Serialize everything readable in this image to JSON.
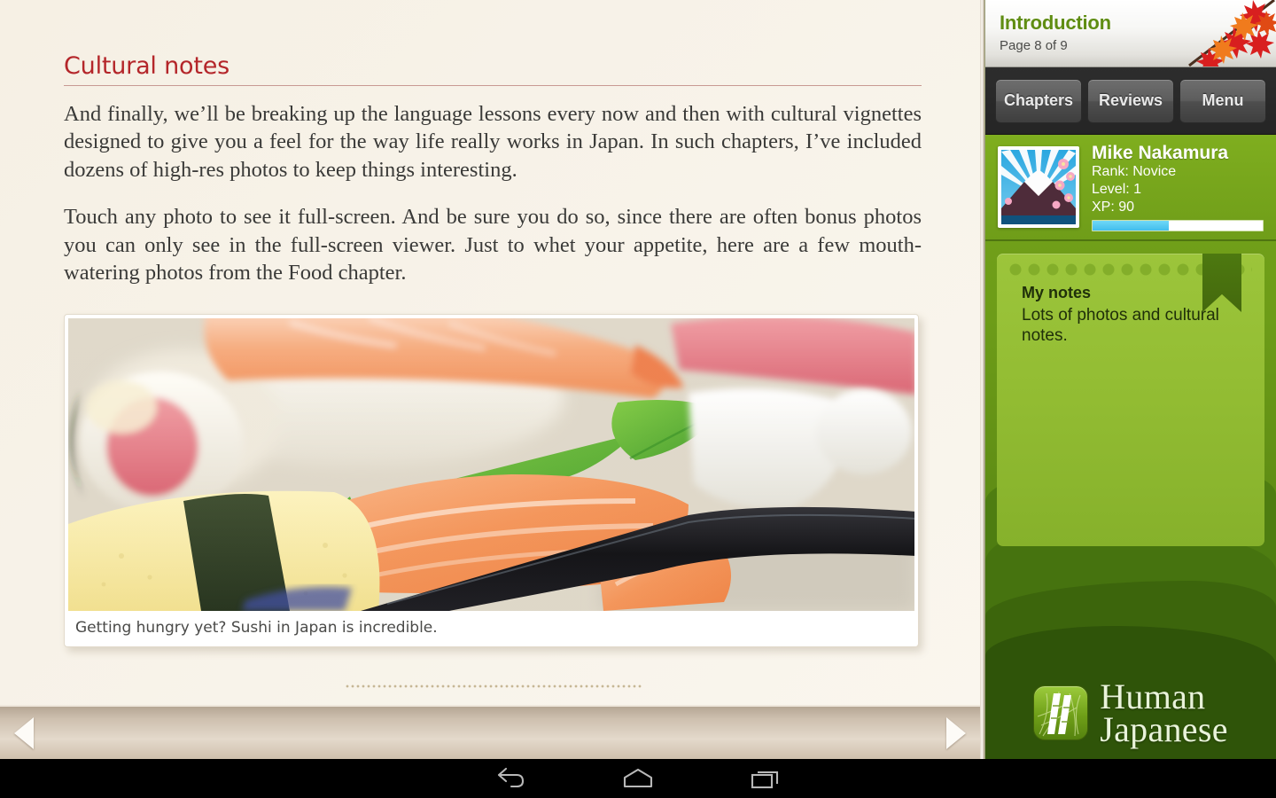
{
  "reader": {
    "heading": "Cultural notes",
    "paragraphs": [
      "And finally, we’ll be breaking up the language lessons every now and then with cultural vignettes designed to give you a feel for the way life really works in Japan. In such chapters, I’ve included dozens of high-res photos to keep things interesting.",
      "Touch any photo to see it full-screen. And be sure you do so, since there are often bonus photos you can only see in the full-screen viewer. Just to whet your appetite, here are a few mouth-watering photos from the Food chapter."
    ],
    "photo": {
      "caption": "Getting hungry yet? Sushi in Japan is incredible.",
      "alt": "sushi-platter-photo"
    },
    "nav": {
      "prev_icon": "triangle-left-icon",
      "next_icon": "triangle-right-icon"
    },
    "divider_icon": "dotted-divider"
  },
  "sidebar": {
    "header": {
      "title": "Introduction",
      "subtitle": "Page 8 of 9",
      "decoration_icon": "maple-leaf-branch-icon"
    },
    "tabs": [
      {
        "label": "Chapters",
        "name": "tab-chapters"
      },
      {
        "label": "Reviews",
        "name": "tab-reviews"
      },
      {
        "label": "Menu",
        "name": "tab-menu"
      }
    ],
    "profile": {
      "name": "Mike Nakamura",
      "rank": "Rank: Novice",
      "level": "Level: 1",
      "xp": "XP: 90",
      "xp_percent": 45,
      "avatar_icon": "mount-fuji-sunrise-avatar"
    },
    "notes": {
      "title": "My notes",
      "body": "Lots of photos and cultural notes.",
      "bookmark_icon": "bookmark-ribbon-icon"
    },
    "logo": {
      "line1": "Human",
      "line2": "Japanese",
      "mark_icon": "bamboo-logo-icon"
    }
  },
  "system_bar": {
    "back_icon": "back-arrow-icon",
    "home_icon": "home-icon",
    "recents_icon": "recents-icon"
  },
  "colors": {
    "heading_red": "#b4262a",
    "sidebar_green": "#7aa81c",
    "title_green": "#5f8d12",
    "xp_blue": "#42bdec",
    "paper": "#f7f2e8"
  }
}
